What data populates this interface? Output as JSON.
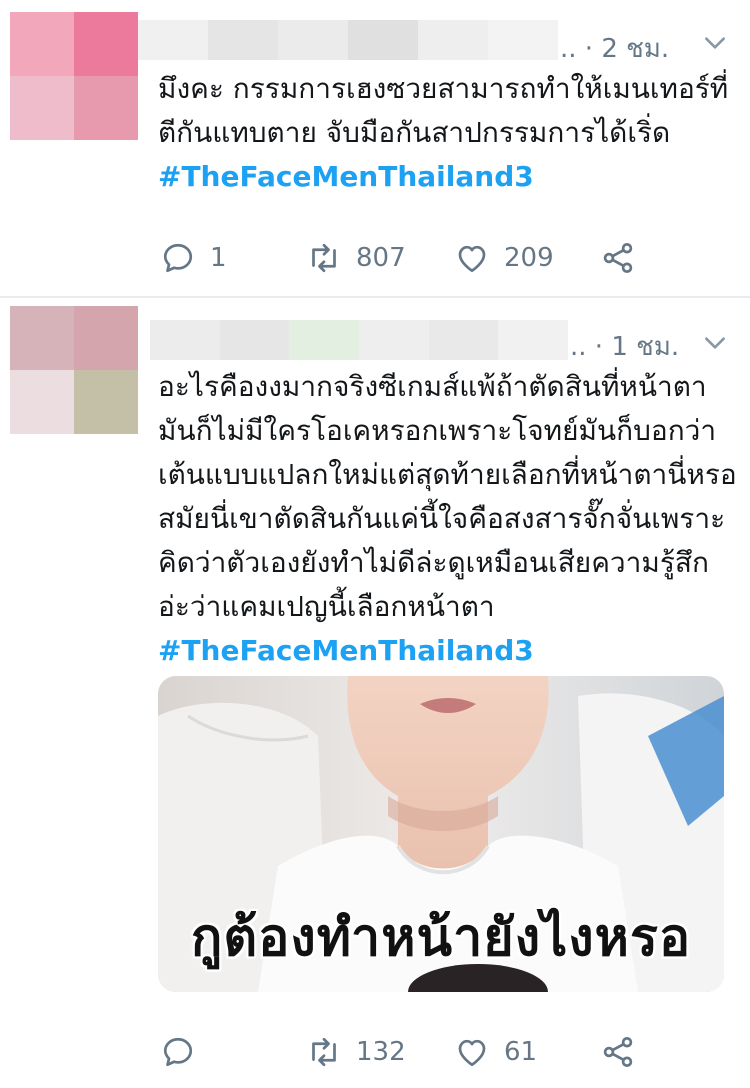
{
  "tweets": [
    {
      "timestamp": ".. · 2 ชม.",
      "text_main": "มึงคะ กรรมการเฮงซวยสามารถทำให้เมนเทอร์ที่ตีกันแทบตาย จับมือกันสาปกรรมการได้เริ่ด ",
      "hashtag": "#TheFaceMenThailand3",
      "avatar_colors": [
        "#f2a7bb",
        "#ec7a9c",
        "#efbccb",
        "#e79aae"
      ],
      "name_blur_colors": [
        "#f0f0f0",
        "#e5e5e5",
        "#ebebeb",
        "#e0e0e0",
        "#eeeeee",
        "#f3f3f3"
      ],
      "actions": {
        "reply_count": "1",
        "retweet_count": "807",
        "like_count": "209"
      }
    },
    {
      "timestamp": ".. · 1 ชม.",
      "text_main": "อะไรคืองงมากจริงซีเกมส์แพ้ถ้าตัดสินที่หน้าตามันก็ไม่มีใครโอเคหรอกเพราะโจทย์มันก็บอกว่าเต้นแบบแปลกใหม่แต่สุดท้ายเลือกที่หน้าตานี่หรอสมัยนี่เขาตัดสินกันแค่นี้ใจคือสงสารจั๊กจั่นเพราะคิดว่าตัวเองยังทำไม่ดีล่ะดูเหมือนเสียความรู้สึกอ่ะว่าแคมเปญนี้เลือกหน้าตา ",
      "hashtag": "#TheFaceMenThailand3",
      "avatar_colors": [
        "#d6b3b8",
        "#d4a5ad",
        "#ebdde0",
        "#c4c0a8"
      ],
      "name_blur_colors": [
        "#ececec",
        "#e6e6e6",
        "#e2efe1",
        "#eeeeee",
        "#e9e9e9",
        "#f1f1f1"
      ],
      "media_caption": "กูต้องทำหน้ายังไงหรอ",
      "actions": {
        "reply_count": "",
        "retweet_count": "132",
        "like_count": "61"
      }
    }
  ],
  "colors": {
    "hashtag": "#1da1f2",
    "meta": "#657786",
    "text": "#14171a",
    "divider": "#e6ecf0"
  },
  "icons": [
    "reply-icon",
    "retweet-icon",
    "like-icon",
    "share-icon",
    "chevron-down-icon"
  ]
}
